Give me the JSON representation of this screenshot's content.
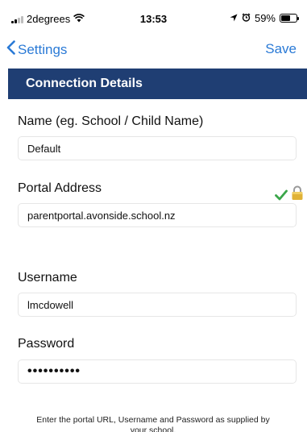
{
  "status_bar": {
    "carrier": "2degrees",
    "time": "13:53",
    "battery_percent": "59%",
    "battery_level": 0.59,
    "icons": [
      "signal-icon",
      "wifi-icon",
      "location-arrow-icon",
      "alarm-icon",
      "battery-icon"
    ]
  },
  "nav": {
    "back_label": "Settings",
    "save_label": "Save",
    "accent_color": "#2a7ad6"
  },
  "section": {
    "title": "Connection Details",
    "color": "#1f3e73"
  },
  "fields": {
    "name": {
      "label": "Name  (eg. School / Child Name)",
      "value": "Default"
    },
    "portal": {
      "label": "Portal Address",
      "value": "parentportal.avonside.school.nz",
      "status_icons": [
        "checkmark-icon",
        "lock-icon"
      ]
    },
    "username": {
      "label": "Username",
      "value": "lmcdowell"
    },
    "password": {
      "label": "Password",
      "value": "••••••••••"
    }
  },
  "hint": "Enter the portal URL, Username and Password as supplied by your school."
}
